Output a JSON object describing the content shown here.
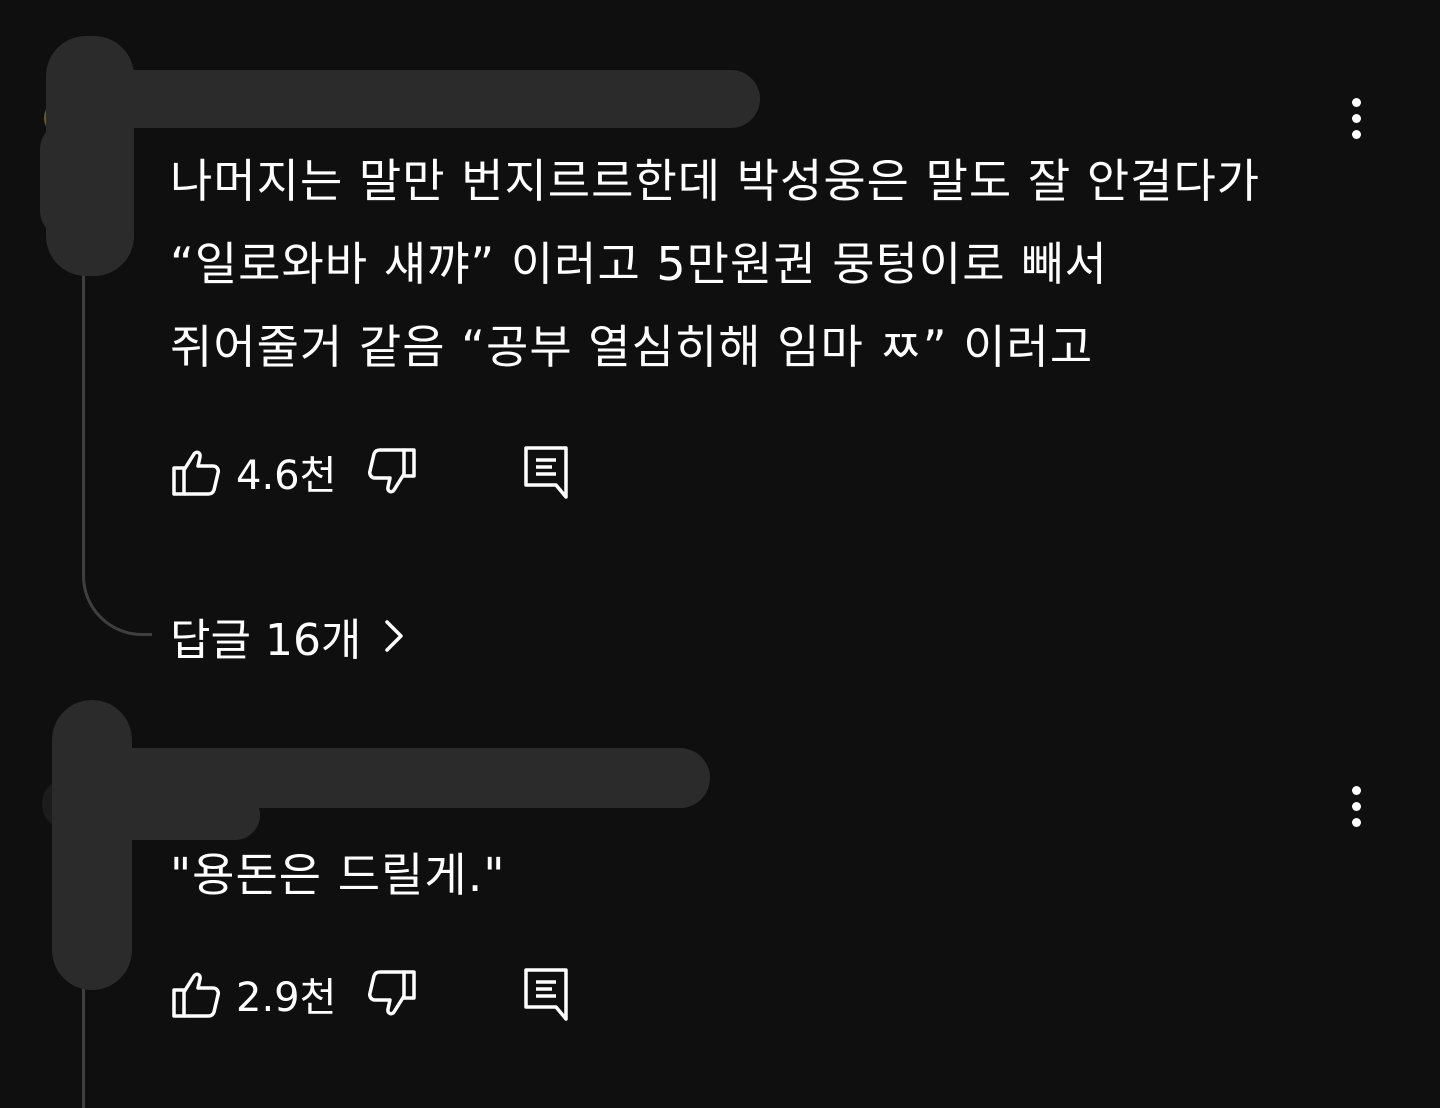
{
  "comments": [
    {
      "author_text": "",
      "lines": [
        "나머지는 말만 번지르르한데 박성웅은 말도 잘 안걸다가",
        "“일로와바 섀꺄” 이러고 5만원권 뭉텅이로 빼서",
        "쥐어줄거 같음 “공부 열심히해 임마 ㅉ” 이러고"
      ],
      "like_count": "4.6천",
      "replies_label": "답글 16개"
    },
    {
      "author_text": "",
      "lines": [
        "\"용돈은 드릴게.\""
      ],
      "like_count": "2.9천"
    }
  ],
  "icons": {
    "like": "thumbs-up-icon",
    "dislike": "thumbs-down-icon",
    "reply": "reply-comment-icon",
    "more": "more-vertical-icon",
    "chevron": "chevron-right-icon"
  },
  "colors": {
    "background": "#0f0f0f",
    "text": "#ffffff",
    "thread_line": "#3f3f3f",
    "redaction": "#2b2b2b"
  }
}
